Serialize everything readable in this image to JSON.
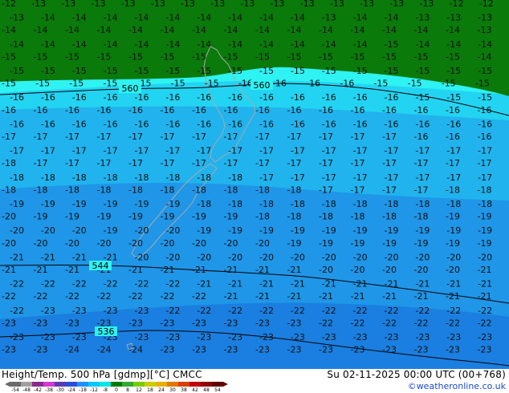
{
  "title": "Height/Temp. 500 hPa [gdmp][°C] CMCC",
  "datetime": "Su 02-11-2025 00:00 UTC (00+768)",
  "credit": "©weatheronline.co.uk",
  "colorbar": {
    "ticks": [
      "-54",
      "-48",
      "-42",
      "-38",
      "-30",
      "-24",
      "-18",
      "-12",
      "-8",
      "0",
      "8",
      "12",
      "18",
      "24",
      "30",
      "38",
      "42",
      "48",
      "54"
    ],
    "colors": [
      "#6a6a6a",
      "#a0a0a0",
      "#8b2c8b",
      "#d33ad3",
      "#5a3ab0",
      "#2a4fd6",
      "#1e90ff",
      "#00c8ff",
      "#00e5e5",
      "#007a00",
      "#33aa33",
      "#7acc00",
      "#cccc00",
      "#e6b000",
      "#e07800",
      "#d84000",
      "#c00000",
      "#900000",
      "#600000"
    ]
  },
  "contours": [
    "560",
    "560",
    "544",
    "536"
  ],
  "temp_rows": [
    {
      "row": 1,
      "values": [
        "-12",
        "-13",
        "-13",
        "-13",
        "-13",
        "-13",
        "-13",
        "-13",
        "-13",
        "-13",
        "-13",
        "-13",
        "-13",
        "-13",
        "-13",
        "-12",
        "-12"
      ]
    },
    {
      "row": 2,
      "values": [
        "-13",
        "-14",
        "-14",
        "-14",
        "-14",
        "-14",
        "-14",
        "-14",
        "-14",
        "-14",
        "-13",
        "-14",
        "-14",
        "-13",
        "-13",
        "-13"
      ]
    },
    {
      "row": 3,
      "values": [
        "-14",
        "-14",
        "-14",
        "-14",
        "-14",
        "-14",
        "-14",
        "-14",
        "-14",
        "-14",
        "-14",
        "-14",
        "-14",
        "-14",
        "-14",
        "-13"
      ]
    },
    {
      "row": 4,
      "values": [
        "-14",
        "-14",
        "-14",
        "-14",
        "-14",
        "-14",
        "-14",
        "-14",
        "-14",
        "-14",
        "-14",
        "-14",
        "-15",
        "-14",
        "-14",
        "-14"
      ]
    },
    {
      "row": 5,
      "values": [
        "-15",
        "-15",
        "-15",
        "-15",
        "-15",
        "-15",
        "-15",
        "-15",
        "-15",
        "-15",
        "-15",
        "-15",
        "-15",
        "-15",
        "-15",
        "-14"
      ]
    },
    {
      "row": 6,
      "values": [
        "-15",
        "-15",
        "-15",
        "-15",
        "-15",
        "-15",
        "-15",
        "-15",
        "-15",
        "-15",
        "-15",
        "-15",
        "-15",
        "-15",
        "-15",
        "-15"
      ]
    },
    {
      "row": 7,
      "values": [
        "-15",
        "-15",
        "-15",
        "-15",
        "-15",
        "-15",
        "-15",
        "-16",
        "-16",
        "-16",
        "-16",
        "-15",
        "-15",
        "-15",
        "-15"
      ]
    },
    {
      "row": 8,
      "values": [
        "-16",
        "-16",
        "-16",
        "-16",
        "-16",
        "-16",
        "-16",
        "-16",
        "-16",
        "-16",
        "-16",
        "-16",
        "-16",
        "-15",
        "-15",
        "-15"
      ]
    },
    {
      "row": 9,
      "values": [
        "-16",
        "-16",
        "-16",
        "-16",
        "-16",
        "-16",
        "-16",
        "-16",
        "-16",
        "-16",
        "-16",
        "-16",
        "-16",
        "-16",
        "-16",
        "-16"
      ]
    },
    {
      "row": 10,
      "values": [
        "-16",
        "-16",
        "-16",
        "-16",
        "-16",
        "-16",
        "-16",
        "-16",
        "-16",
        "-16",
        "-16",
        "-16",
        "-16",
        "-16",
        "-16",
        "-16"
      ]
    },
    {
      "row": 11,
      "values": [
        "-17",
        "-17",
        "-17",
        "-17",
        "-17",
        "-17",
        "-17",
        "-17",
        "-17",
        "-17",
        "-17",
        "-17",
        "-17",
        "-16",
        "-16",
        "-16"
      ]
    },
    {
      "row": 12,
      "values": [
        "-17",
        "-17",
        "-17",
        "-17",
        "-17",
        "-17",
        "-17",
        "-17",
        "-17",
        "-17",
        "-17",
        "-17",
        "-17",
        "-17",
        "-17",
        "-17"
      ]
    },
    {
      "row": 13,
      "values": [
        "-18",
        "-17",
        "-17",
        "-17",
        "-17",
        "-17",
        "-17",
        "-17",
        "-17",
        "-17",
        "-17",
        "-17",
        "-17",
        "-17",
        "-17",
        "-17"
      ]
    },
    {
      "row": 14,
      "values": [
        "-18",
        "-18",
        "-18",
        "-18",
        "-18",
        "-18",
        "-18",
        "-18",
        "-17",
        "-17",
        "-17",
        "-17",
        "-17",
        "-17",
        "-17",
        "-17"
      ]
    },
    {
      "row": 15,
      "values": [
        "-18",
        "-18",
        "-18",
        "-18",
        "-18",
        "-18",
        "-18",
        "-18",
        "-18",
        "-18",
        "-17",
        "-17",
        "-17",
        "-17",
        "-18",
        "-18"
      ]
    },
    {
      "row": 16,
      "values": [
        "-19",
        "-19",
        "-19",
        "-19",
        "-19",
        "-19",
        "-18",
        "-18",
        "-18",
        "-18",
        "-18",
        "-18",
        "-18",
        "-18",
        "-18",
        "-18"
      ]
    },
    {
      "row": 17,
      "values": [
        "-20",
        "-19",
        "-19",
        "-19",
        "-19",
        "-19",
        "-19",
        "-19",
        "-18",
        "-18",
        "-18",
        "-18",
        "-18",
        "-18",
        "-19",
        "-19"
      ]
    },
    {
      "row": 18,
      "values": [
        "-20",
        "-20",
        "-20",
        "-19",
        "-20",
        "-20",
        "-19",
        "-19",
        "-19",
        "-19",
        "-19",
        "-19",
        "-19",
        "-19",
        "-19",
        "-19"
      ]
    },
    {
      "row": 19,
      "values": [
        "-20",
        "-20",
        "-20",
        "-20",
        "-20",
        "-20",
        "-20",
        "-20",
        "-20",
        "-19",
        "-19",
        "-19",
        "-19",
        "-19",
        "-19",
        "-19"
      ]
    },
    {
      "row": 20,
      "values": [
        "-21",
        "-21",
        "-21",
        "-21",
        "-20",
        "-20",
        "-20",
        "-20",
        "-20",
        "-20",
        "-20",
        "-20",
        "-20",
        "-20",
        "-20",
        "-20"
      ]
    },
    {
      "row": 21,
      "values": [
        "-21",
        "-21",
        "-21",
        "-21",
        "-21",
        "-21",
        "-21",
        "-21",
        "-21",
        "-21",
        "-20",
        "-20",
        "-20",
        "-20",
        "-20",
        "-21"
      ]
    },
    {
      "row": 22,
      "values": [
        "-22",
        "-22",
        "-22",
        "-22",
        "-22",
        "-22",
        "-21",
        "-21",
        "-21",
        "-21",
        "-21",
        "-21",
        "-21",
        "-21",
        "-21",
        "-21"
      ]
    },
    {
      "row": 23,
      "values": [
        "-22",
        "-22",
        "-22",
        "-22",
        "-22",
        "-22",
        "-22",
        "-21",
        "-21",
        "-21",
        "-21",
        "-21",
        "-21",
        "-21",
        "-21",
        "-21"
      ]
    },
    {
      "row": 24,
      "values": [
        "-22",
        "-23",
        "-23",
        "-23",
        "-23",
        "-22",
        "-22",
        "-22",
        "-22",
        "-22",
        "-22",
        "-22",
        "-22",
        "-22",
        "-22",
        "-22"
      ]
    },
    {
      "row": 25,
      "values": [
        "-23",
        "-23",
        "-23",
        "-23",
        "-23",
        "-23",
        "-23",
        "-23",
        "-23",
        "-23",
        "-22",
        "-22",
        "-22",
        "-22",
        "-22",
        "-22"
      ]
    },
    {
      "row": 26,
      "values": [
        "-23",
        "-23",
        "-23",
        "-23",
        "-23",
        "-23",
        "-23",
        "-23",
        "-23",
        "-23",
        "-23",
        "-23",
        "-23",
        "-23",
        "-23",
        "-23"
      ]
    },
    {
      "row": 27,
      "values": [
        "-23",
        "-23",
        "-24",
        "-24",
        "-24",
        "-23",
        "-23",
        "-23",
        "-23",
        "-23",
        "-23",
        "-23",
        "-23",
        "-23",
        "-23",
        "-23"
      ]
    }
  ],
  "legend_colors": {
    "dark_green": "#0a7a0a",
    "cyan_light": "#2ff2f2",
    "cyan": "#22d4f2",
    "sky": "#21b3ee",
    "blue": "#1f96e8",
    "blue_deep": "#1a7fe0",
    "coast": "#a8a8a8",
    "contour": "#000000"
  }
}
